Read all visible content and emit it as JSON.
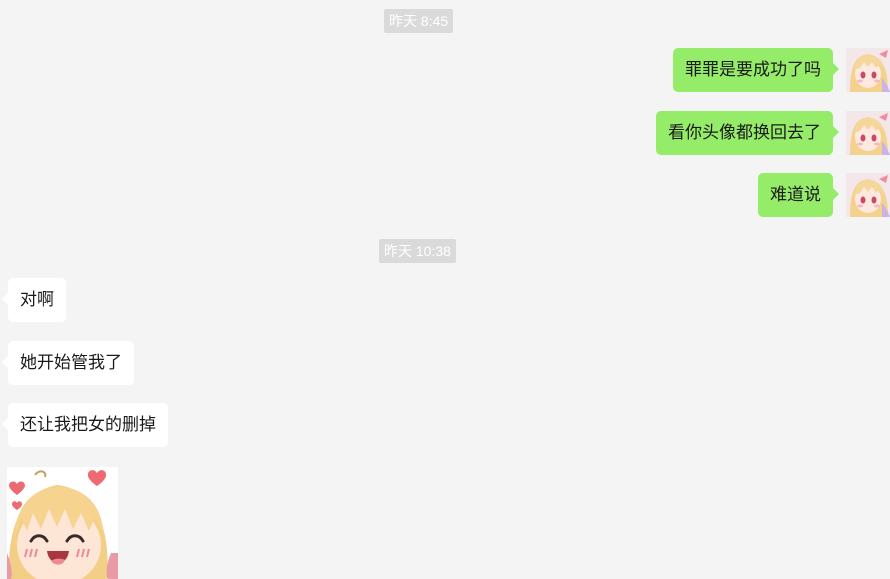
{
  "timestamps": [
    "昨天 8:45",
    "昨天 10:38"
  ],
  "messages": [
    {
      "side": "out",
      "text": "罪罪是要成功了吗"
    },
    {
      "side": "out",
      "text": "看你头像都换回去了"
    },
    {
      "side": "out",
      "text": "难道说"
    },
    {
      "side": "in",
      "text": "对啊"
    },
    {
      "side": "in",
      "text": "她开始管我了"
    },
    {
      "side": "in",
      "text": "还让我把女的删掉"
    }
  ],
  "colors": {
    "background": "#f4f4f4",
    "outgoing_bubble": "#95ec69",
    "incoming_bubble": "#ffffff",
    "timestamp_bg": "#dadada",
    "text": "#1a1a1a"
  },
  "icons": {
    "avatar": "anime-girl-avatar-icon",
    "sticker": "laughing-anime-girl-sticker-icon"
  }
}
